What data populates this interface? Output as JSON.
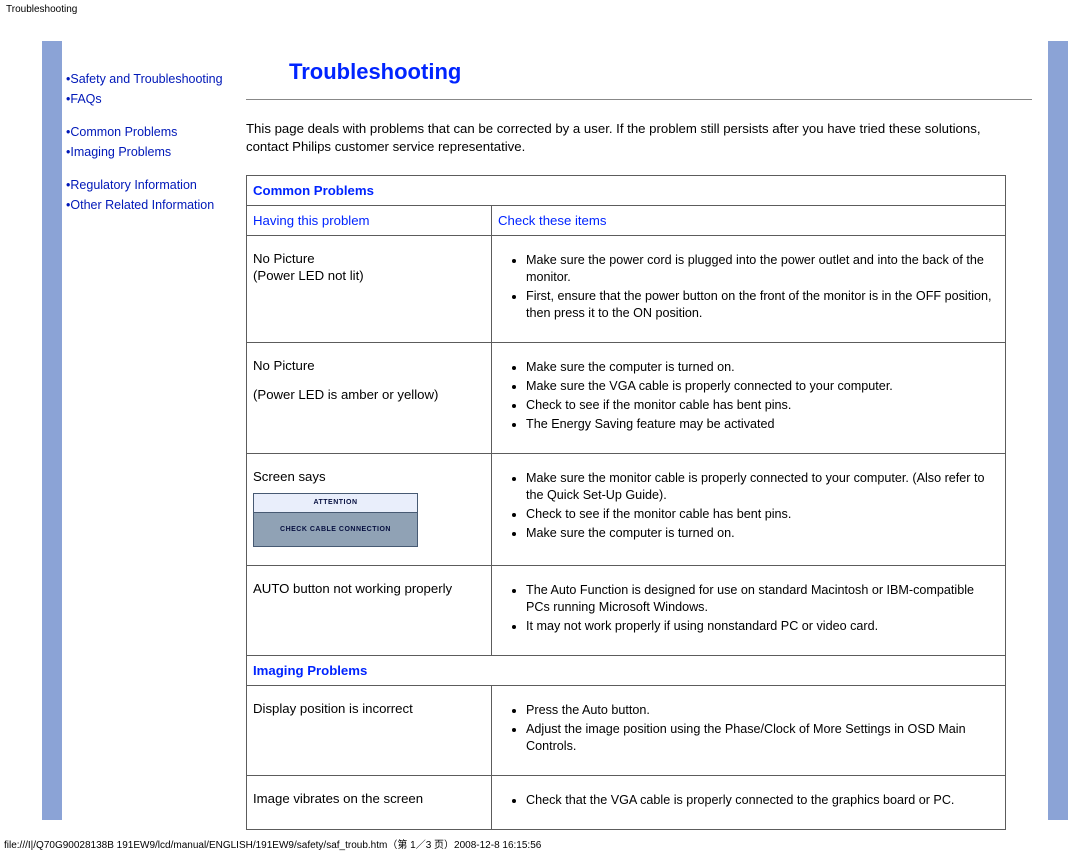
{
  "header_label": "Troubleshooting",
  "sidebar": {
    "links": [
      "Safety and Troubleshooting",
      "FAQs",
      "Common Problems",
      "Imaging Problems",
      "Regulatory Information",
      "Other Related Information"
    ]
  },
  "page": {
    "title": "Troubleshooting",
    "intro": "This page deals with problems that can be corrected by a user. If the problem still persists after you have tried these solutions, contact Philips customer service representative."
  },
  "sections": {
    "common": "Common Problems",
    "imaging": "Imaging Problems"
  },
  "columns": {
    "left": "Having this problem",
    "right": "Check these items"
  },
  "rows": {
    "r1": {
      "problem_line1": "No Picture",
      "problem_line2": "(Power LED not lit)",
      "checks": [
        "Make sure the power cord is plugged into the power outlet and into the back of the monitor.",
        "First, ensure that the power button on the front of the monitor is in the OFF position, then press it to the ON position."
      ]
    },
    "r2": {
      "problem_line1": "No Picture",
      "problem_line2": "(Power LED is amber or yellow)",
      "checks": [
        "Make sure the computer is turned on.",
        "Make sure the VGA cable is properly connected to your computer.",
        "Check to see if the monitor cable has bent pins.",
        "The Energy Saving feature may be activated"
      ]
    },
    "r3": {
      "problem": "Screen says",
      "attention_title": "ATTENTION",
      "attention_body": "CHECK CABLE CONNECTION",
      "checks": [
        "Make sure the monitor cable is properly connected to your computer. (Also refer to the Quick Set-Up Guide).",
        "Check to see if the monitor cable has bent pins.",
        "Make sure the computer is turned on."
      ]
    },
    "r4": {
      "problem": "AUTO button not working properly",
      "checks": [
        "The Auto Function is designed for use on standard Macintosh or IBM-compatible PCs running Microsoft Windows.",
        "It may not work properly if using nonstandard PC or video card."
      ]
    },
    "r5": {
      "problem": "Display position is incorrect",
      "checks": [
        "Press the Auto button.",
        "Adjust the image position using the Phase/Clock of More Settings in OSD Main Controls."
      ]
    },
    "r6": {
      "problem": "Image vibrates on the screen",
      "checks": [
        "Check that the VGA cable is properly connected to the graphics board or PC."
      ]
    }
  },
  "footer_path": "file:///I|/Q70G90028138B 191EW9/lcd/manual/ENGLISH/191EW9/safety/saf_troub.htm（第 1／3 页）2008-12-8 16:15:56"
}
